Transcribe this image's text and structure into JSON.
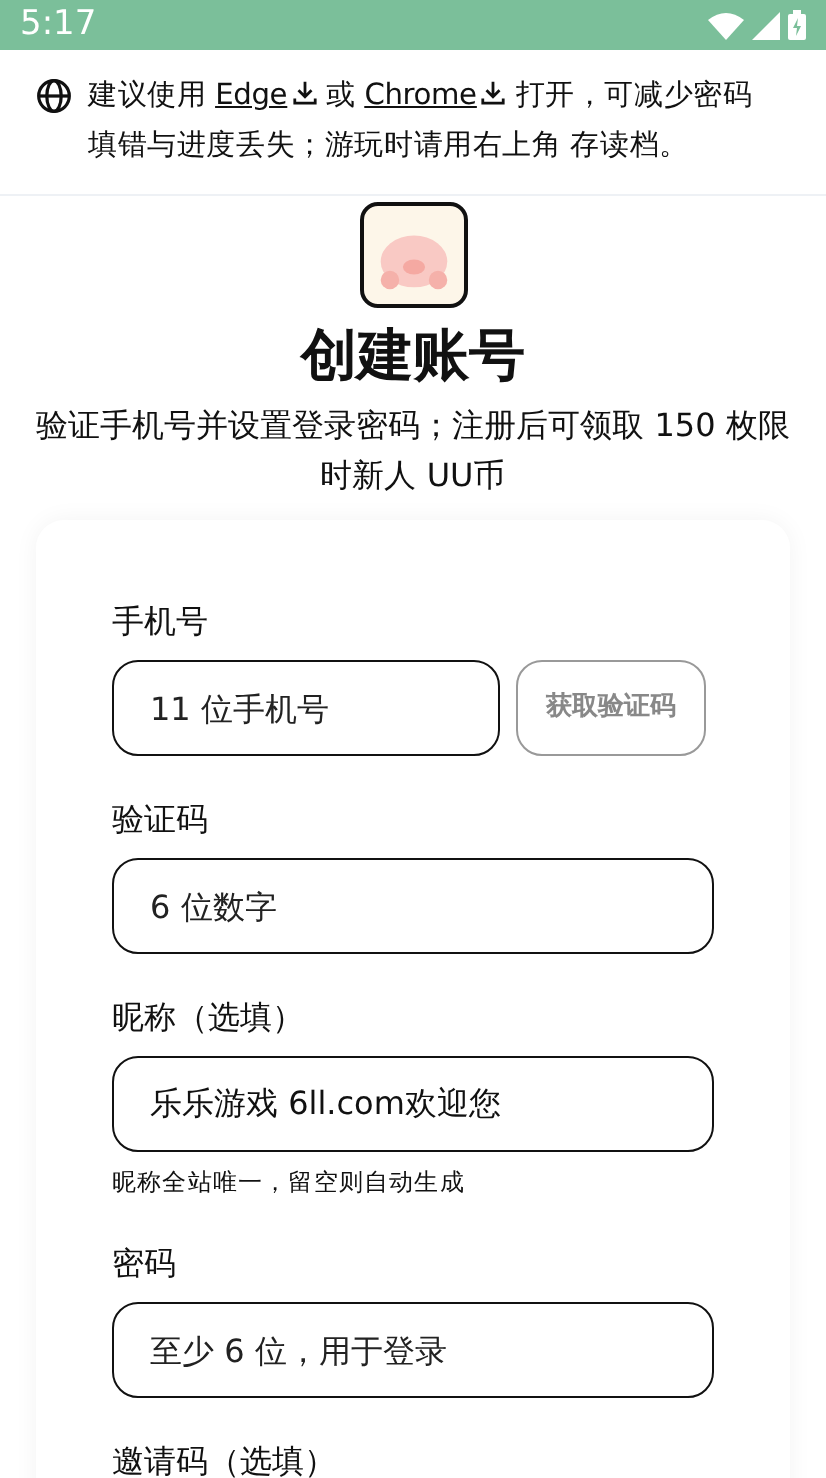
{
  "status_bar": {
    "time": "5:17"
  },
  "notice": {
    "segments": [
      {
        "kind": "text",
        "text": "建议使用 "
      },
      {
        "kind": "link",
        "text": "Edge"
      },
      {
        "kind": "text",
        "text": " 或 "
      },
      {
        "kind": "link",
        "text": "Chrome"
      },
      {
        "kind": "text",
        "text": " 打开，可减少密码填错与进度丢失；游玩时请用右上角 存读档。"
      }
    ]
  },
  "title": "创建账号",
  "subtitle": "验证手机号并设置登录密码；注册后可领取 150 枚限时新人 UU币",
  "fields": [
    {
      "kind": "input",
      "label": "手机号",
      "placeholder": "11 位手机号",
      "button": {
        "label": "获取验证码",
        "disabled": true
      }
    },
    {
      "kind": "input",
      "label": "验证码",
      "placeholder": "6 位数字"
    },
    {
      "kind": "input",
      "label": "昵称（选填）",
      "value": "乐乐游戏 6ll.com欢迎您",
      "hint": "昵称全站唯一，留空则自动生成"
    },
    {
      "kind": "input",
      "label": "密码",
      "placeholder": "至少 6 位，用于登录"
    },
    {
      "kind": "label",
      "label": "邀请码（选填）"
    }
  ]
}
